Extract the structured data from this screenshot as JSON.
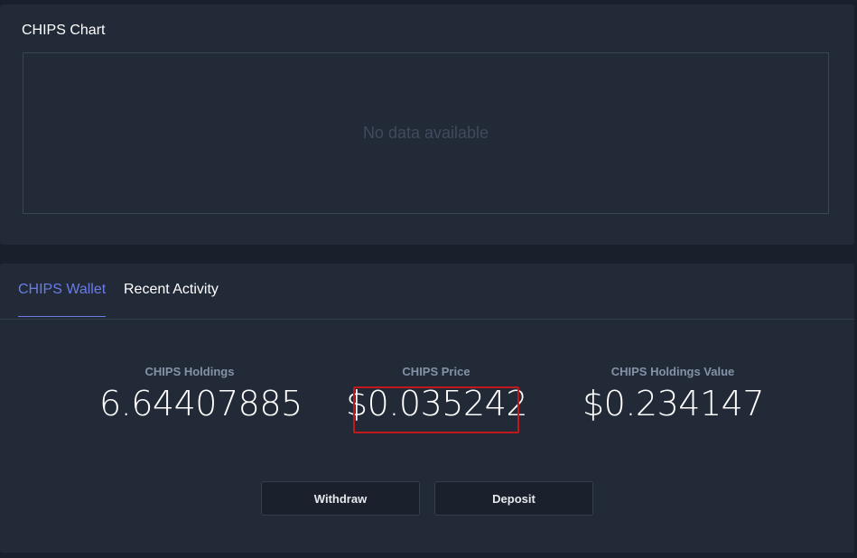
{
  "chart_panel": {
    "title": "CHIPS Chart",
    "empty_message": "No data available"
  },
  "wallet_panel": {
    "tabs": [
      {
        "label": "CHIPS Wallet",
        "active": true
      },
      {
        "label": "Recent Activity",
        "active": false
      }
    ],
    "stats": {
      "holdings": {
        "label": "CHIPS Holdings",
        "value": "6.64407885"
      },
      "price": {
        "label": "CHIPS Price",
        "value": "$0.035242"
      },
      "holdings_value": {
        "label": "CHIPS Holdings Value",
        "value": "$0.234147"
      }
    },
    "buttons": {
      "withdraw": "Withdraw",
      "deposit": "Deposit"
    }
  },
  "colors": {
    "background": "#1a202b",
    "panel": "#222a38",
    "accent": "#6b7ce6",
    "highlight": "#c0181b"
  }
}
